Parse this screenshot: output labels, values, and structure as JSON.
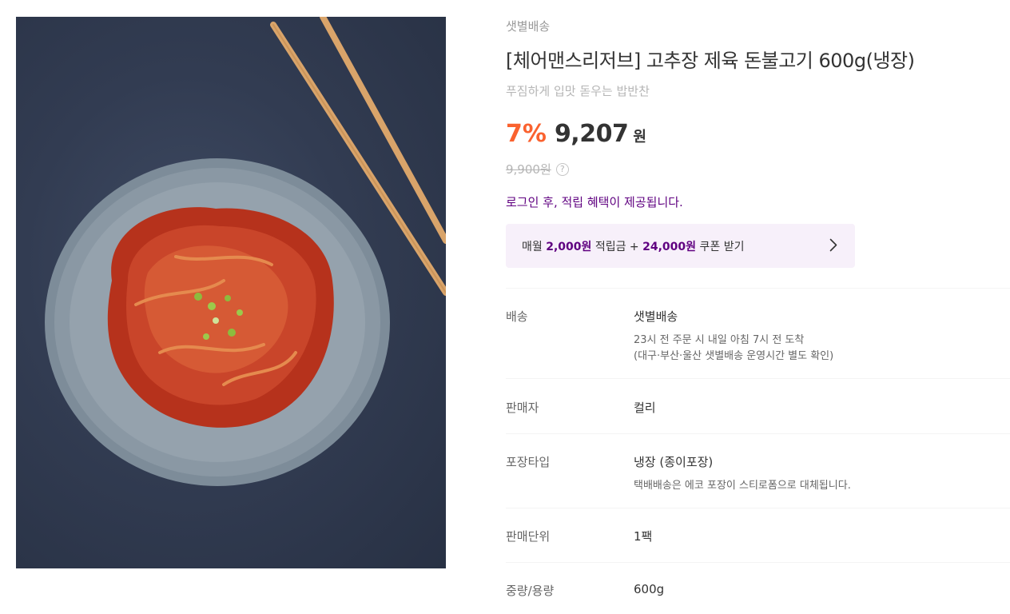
{
  "product": {
    "delivery_type": "샛별배송",
    "title": "[체어맨스리저브] 고추장 제육 돈불고기 600g(냉장)",
    "subtitle": "푸짐하게 입맛 돋우는 밥반찬",
    "discount": "7%",
    "price": "9,207",
    "currency": "원",
    "original_price": "9,900원",
    "help_icon": "?",
    "login_notice": "로그인 후, 적립 혜택이 제공됩니다.",
    "image_icon": "bulgogi-dish-photo"
  },
  "coupon": {
    "prefix": "매월 ",
    "point_amount": "2,000원",
    "middle": " 적립금 + ",
    "coupon_amount": "24,000원",
    "suffix": " 쿠폰 받기",
    "arrow_icon": "chevron-right-icon"
  },
  "details": {
    "delivery": {
      "label": "배송",
      "value": "샛별배송",
      "sub1": "23시 전 주문 시 내일 아침 7시 전 도착",
      "sub2": "(대구·부산·울산 샛별배송 운영시간 별도 확인)"
    },
    "seller": {
      "label": "판매자",
      "value": "컬리"
    },
    "packaging": {
      "label": "포장타입",
      "value": "냉장 (종이포장)",
      "sub1": "택배배송은 에코 포장이 스티로폼으로 대체됩니다."
    },
    "unit": {
      "label": "판매단위",
      "value": "1팩"
    },
    "weight": {
      "label": "중량/용량",
      "value": "600g"
    }
  },
  "colors": {
    "discount": "#fa622f",
    "brand_purple": "#5f0080",
    "coupon_bg": "#f7f0fa",
    "muted": "#b5b5b5"
  }
}
